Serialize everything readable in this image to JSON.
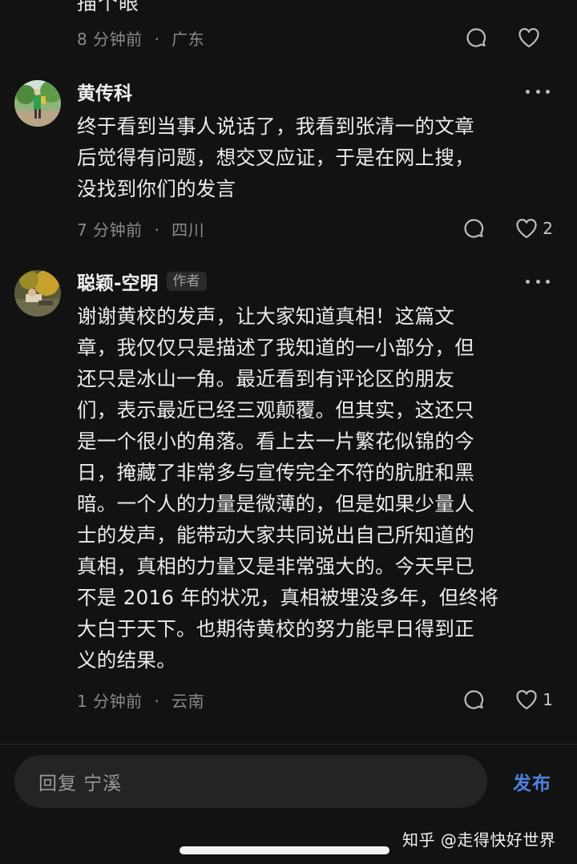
{
  "top_comment": {
    "partial_text": "描个眼",
    "time": "8 分钟前",
    "location": "广东",
    "like_count": ""
  },
  "comments": [
    {
      "author": "黄传科",
      "badge": "",
      "text_lines": [
        "终于看到当事人说话了，我看到张清一的文章",
        "后觉得有问题，想交叉应证，于是在网上搜，",
        "没找到你们的发言"
      ],
      "time": "7 分钟前",
      "location": "四川",
      "like_count": "2"
    },
    {
      "author": "聪颖-空明",
      "badge": "作者",
      "text_lines": [
        "谢谢黄校的发声，让大家知道真相！这篇文",
        "章，我仅仅只是描述了我知道的一小部分，但",
        "还只是冰山一角。最近看到有评论区的朋友",
        "们，表示最近已经三观颠覆。但其实，这还只",
        "是一个很小的角落。看上去一片繁花似锦的今",
        "日，掩藏了非常多与宣传完全不符的肮脏和黑",
        "暗。一个人的力量是微薄的，但是如果少量人",
        "士的发声，能带动大家共同说出自己所知道的",
        "真相，真相的力量又是非常强大的。今天早已",
        "不是 2016 年的状况，真相被埋没多年，但终将",
        "大白于天下。也期待黄校的努力能早日得到正",
        "义的结果。"
      ],
      "time": "1 分钟前",
      "location": "云南",
      "like_count": "1"
    }
  ],
  "meta_separator": "·",
  "reply_bar": {
    "placeholder": "回复 宁溪",
    "send_label": "发布"
  },
  "watermark": "知乎 @走得快好世界",
  "colors": {
    "background": "#121212",
    "accent": "#4f7fe0",
    "secondary_text": "#8a8a8a"
  }
}
